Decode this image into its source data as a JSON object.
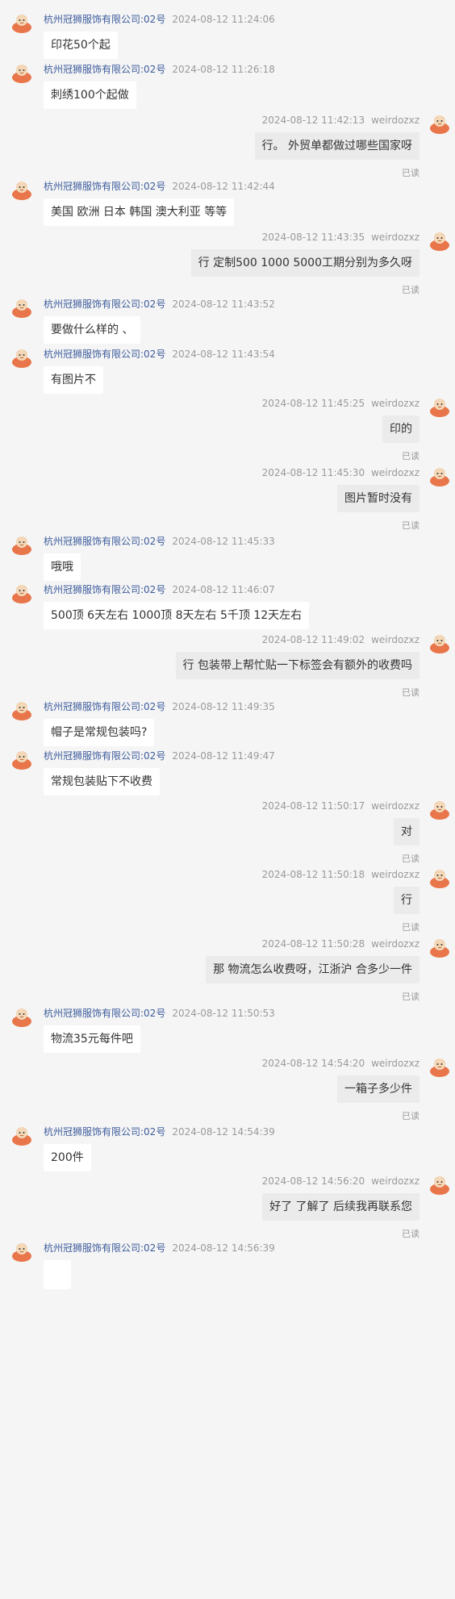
{
  "colors": {
    "background": "#f5f5f5",
    "sender_name": "#3d5c9c",
    "meta_text": "#9a9a9a",
    "incoming_bubble": "#ffffff",
    "outgoing_bubble": "#ebebeb",
    "avatar": "#e8764a"
  },
  "status_read": "已读",
  "messages": [
    {
      "dir": "in",
      "sender": "杭州冠狮服饰有限公司:02号",
      "time": "2024-08-12 11:24:06",
      "text": "印花50个起"
    },
    {
      "dir": "in",
      "sender": "杭州冠狮服饰有限公司:02号",
      "time": "2024-08-12 11:26:18",
      "text": "刺绣100个起做"
    },
    {
      "dir": "out",
      "sender": "weirdozxz",
      "time": "2024-08-12 11:42:13",
      "text": "行。 外贸单都做过哪些国家呀",
      "read": "已读"
    },
    {
      "dir": "in",
      "sender": "杭州冠狮服饰有限公司:02号",
      "time": "2024-08-12 11:42:44",
      "text": "美国 欧洲 日本 韩国 澳大利亚  等等"
    },
    {
      "dir": "out",
      "sender": "weirdozxz",
      "time": "2024-08-12 11:43:35",
      "text": "行 定制500 1000 5000工期分别为多久呀",
      "read": "已读"
    },
    {
      "dir": "in",
      "sender": "杭州冠狮服饰有限公司:02号",
      "time": "2024-08-12 11:43:52",
      "text": "要做什么样的 、"
    },
    {
      "dir": "in",
      "sender": "杭州冠狮服饰有限公司:02号",
      "time": "2024-08-12 11:43:54",
      "text": "有图片不"
    },
    {
      "dir": "out",
      "sender": "weirdozxz",
      "time": "2024-08-12 11:45:25",
      "text": "印的",
      "read": "已读"
    },
    {
      "dir": "out",
      "sender": "weirdozxz",
      "time": "2024-08-12 11:45:30",
      "text": "图片暂时没有",
      "read": "已读"
    },
    {
      "dir": "in",
      "sender": "杭州冠狮服饰有限公司:02号",
      "time": "2024-08-12 11:45:33",
      "text": "哦哦"
    },
    {
      "dir": "in",
      "sender": "杭州冠狮服饰有限公司:02号",
      "time": "2024-08-12 11:46:07",
      "text": "500顶 6天左右 1000顶 8天左右 5千顶 12天左右"
    },
    {
      "dir": "out",
      "sender": "weirdozxz",
      "time": "2024-08-12 11:49:02",
      "text": "行 包装带上帮忙贴一下标签会有额外的收费吗",
      "read": "已读"
    },
    {
      "dir": "in",
      "sender": "杭州冠狮服饰有限公司:02号",
      "time": "2024-08-12 11:49:35",
      "text": "帽子是常规包装吗?"
    },
    {
      "dir": "in",
      "sender": "杭州冠狮服饰有限公司:02号",
      "time": "2024-08-12 11:49:47",
      "text": "常规包装贴下不收费"
    },
    {
      "dir": "out",
      "sender": "weirdozxz",
      "time": "2024-08-12 11:50:17",
      "text": "对",
      "read": "已读"
    },
    {
      "dir": "out",
      "sender": "weirdozxz",
      "time": "2024-08-12 11:50:18",
      "text": "行",
      "read": "已读"
    },
    {
      "dir": "out",
      "sender": "weirdozxz",
      "time": "2024-08-12 11:50:28",
      "text": "那 物流怎么收费呀，江浙沪 合多少一件",
      "read": "已读"
    },
    {
      "dir": "in",
      "sender": "杭州冠狮服饰有限公司:02号",
      "time": "2024-08-12 11:50:53",
      "text": "物流35元每件吧"
    },
    {
      "dir": "out",
      "sender": "weirdozxz",
      "time": "2024-08-12 14:54:20",
      "text": "一箱子多少件",
      "read": "已读"
    },
    {
      "dir": "in",
      "sender": "杭州冠狮服饰有限公司:02号",
      "time": "2024-08-12 14:54:39",
      "text": "200件"
    },
    {
      "dir": "out",
      "sender": "weirdozxz",
      "time": "2024-08-12 14:56:20",
      "text": "好了 了解了 后续我再联系您",
      "read": "已读"
    },
    {
      "dir": "in",
      "sender": "杭州冠狮服饰有限公司:02号",
      "time": "2024-08-12 14:56:39",
      "text": ""
    }
  ]
}
